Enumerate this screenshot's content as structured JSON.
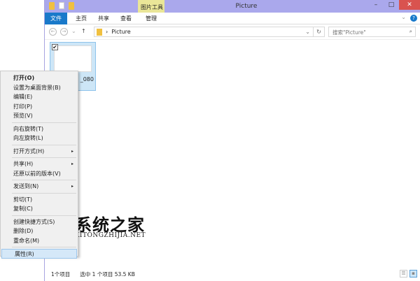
{
  "window": {
    "title": "Picture",
    "context_tab": "图片工具",
    "controls": {
      "minimize": "–",
      "maximize": "□",
      "close": "✕"
    }
  },
  "ribbon": {
    "tabs": [
      "文件",
      "主页",
      "共享",
      "查看",
      "管理"
    ],
    "help": "?",
    "expand": "⌄"
  },
  "address": {
    "back": "←",
    "forward": "→",
    "recent": "⌄",
    "up": "↑",
    "separator": "›",
    "path": "Picture",
    "dropdown": "⌄",
    "refresh": "↻",
    "search_placeholder": "搜索\"Picture\"",
    "search_icon": "⌕"
  },
  "file": {
    "name": "_080",
    "checked": "✔"
  },
  "status": {
    "count": "1个项目",
    "selected": "选中 1 个项目",
    "size": "53.5 KB",
    "details_view": "☰",
    "tiles_view": "▪"
  },
  "menu": {
    "items": [
      {
        "label": "打开(O)",
        "bold": true
      },
      {
        "label": "设置为桌面背景(B)"
      },
      {
        "label": "编辑(E)"
      },
      {
        "label": "打印(P)"
      },
      {
        "label": "预览(V)"
      },
      {
        "sep": true
      },
      {
        "label": "向右旋转(T)"
      },
      {
        "label": "向左旋转(L)"
      },
      {
        "sep": true
      },
      {
        "label": "打开方式(H)",
        "sub": true
      },
      {
        "sep": true
      },
      {
        "label": "共享(H)",
        "sub": true
      },
      {
        "label": "还原以前的版本(V)"
      },
      {
        "sep": true
      },
      {
        "label": "发送到(N)",
        "sub": true
      },
      {
        "sep": true
      },
      {
        "label": "剪切(T)"
      },
      {
        "label": "复制(C)"
      },
      {
        "sep": true
      },
      {
        "label": "创建快捷方式(S)"
      },
      {
        "label": "删除(D)"
      },
      {
        "label": "重命名(M)"
      },
      {
        "sep": true
      },
      {
        "label": "属性(R)",
        "hl": true
      }
    ],
    "submenu_arrow": "▸"
  },
  "watermark": {
    "title": "系统之家",
    "url": "XITONGZHIJIA.NET"
  }
}
